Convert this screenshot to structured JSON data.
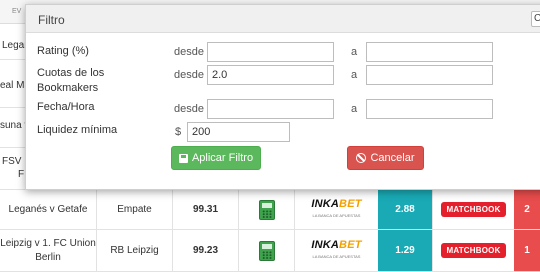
{
  "background": {
    "header_fragment": "EV",
    "partial_rows": [
      {
        "text": "Leganés"
      },
      {
        "text": "eal Ma"
      },
      {
        "text": "suna v"
      },
      {
        "text": "FSV M",
        "text2": "F"
      }
    ],
    "rows": [
      {
        "event": "Leganés v Getafe",
        "bet": "Empate",
        "rating": "99.31",
        "bookmaker": {
          "name_main": "INKA",
          "name_accent": "BET",
          "tagline": "LA BANCA DE APUESTAS"
        },
        "back_odds": "2.88",
        "exchange": "MATCHBOOK",
        "lay_odds": "2"
      },
      {
        "event": "Leipzig v 1. FC Union Berlin",
        "bet": "RB Leipzig",
        "rating": "99.23",
        "bookmaker": {
          "name_main": "INKA",
          "name_accent": "BET",
          "tagline": "LA BANCA DE APUESTAS"
        },
        "back_odds": "1.29",
        "exchange": "MATCHBOOK",
        "lay_odds": "1"
      }
    ]
  },
  "modal": {
    "title": "Filtro",
    "close_label": "C",
    "fields": {
      "rating": {
        "label": "Rating (%)",
        "from_label": "desde",
        "from_value": "",
        "to_label": "a",
        "to_value": ""
      },
      "odds": {
        "label": "Cuotas de los Bookmakers",
        "from_label": "desde",
        "from_value": "2.0",
        "to_label": "a",
        "to_value": ""
      },
      "date": {
        "label": "Fecha/Hora",
        "from_label": "desde",
        "from_value": "",
        "to_label": "a",
        "to_value": ""
      },
      "liquidity": {
        "label": "Liquidez mínima",
        "currency": "$",
        "value": "200"
      }
    },
    "apply_label": "Aplicar Filtro",
    "cancel_label": "Cancelar"
  },
  "colors": {
    "back": "#19aab5",
    "lay": "#e84c4c",
    "apply": "#5cb85c",
    "cancel": "#d9534f",
    "matchbook": "#e3202b"
  },
  "icons": [
    "calculator-icon",
    "save-icon",
    "ban-icon"
  ]
}
